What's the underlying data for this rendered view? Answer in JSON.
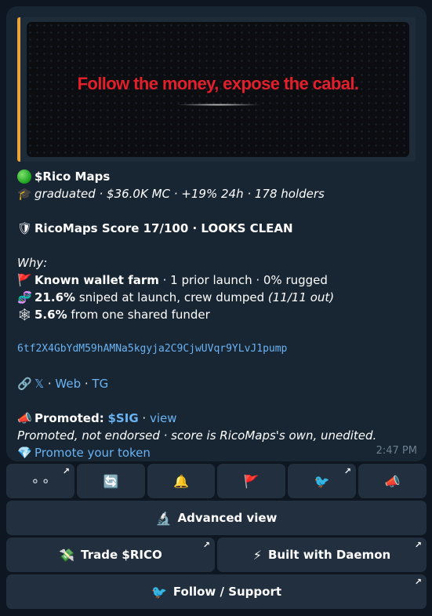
{
  "message": {
    "banner_text": "Follow the money, expose the cabal.",
    "header": {
      "status_icon": "green-circle-icon",
      "name": "$Rico Maps",
      "grad_icon": "graduation-cap-icon",
      "stats": "graduated · $36.0K MC · +19% 24h · 178 holders"
    },
    "score": {
      "icon": "shield-icon",
      "text": "RicoMaps Score 17/100 · LOOKS CLEAN"
    },
    "why": {
      "label": "Why:",
      "items": [
        {
          "icon": "red-flag-icon",
          "bold": "Known wallet farm",
          "rest": " · 1 prior launch · 0% rugged",
          "italic": ""
        },
        {
          "icon": "dna-icon",
          "bold": "21.6%",
          "rest": " sniped at launch, crew dumped ",
          "italic": "(11/11 out)"
        },
        {
          "icon": "spider-web-icon",
          "bold": "5.6%",
          "rest": " from one shared funder",
          "italic": ""
        }
      ]
    },
    "contract": "6tf2X4GbYdM59hAMNa5kgyja2C9CjwUVqr9YLvJ1pump",
    "links": {
      "icon": "link-icon",
      "x": "𝕏",
      "sep": " · ",
      "web": "Web",
      "tg": "TG"
    },
    "promo": {
      "icon": "megaphone-icon",
      "label": "Promoted:",
      "ticker": "$SIG",
      "sep": " · ",
      "view": "view",
      "disclaimer": "Promoted, not endorsed · score is RicoMaps's own, unedited.",
      "cta_icon": "gem-icon",
      "cta": "Promote your token"
    },
    "time": "2:47 PM"
  },
  "keyboard": {
    "row1": [
      {
        "icon": "bubbles-icon",
        "glyph": "⚬⚬",
        "external": true
      },
      {
        "icon": "refresh-icon",
        "glyph": "🔄",
        "external": false
      },
      {
        "icon": "bell-icon",
        "glyph": "🔔",
        "external": false
      },
      {
        "icon": "red-flag-icon",
        "glyph": "🚩",
        "external": false
      },
      {
        "icon": "bird-icon",
        "glyph": "🐦",
        "external": true
      },
      {
        "icon": "megaphone-icon",
        "glyph": "📣",
        "external": false
      }
    ],
    "advanced": {
      "icon": "microscope-icon",
      "glyph": "🔬",
      "label": "Advanced view"
    },
    "trade": {
      "icon": "money-wings-icon",
      "glyph": "💸",
      "label": "Trade $RICO"
    },
    "daemon": {
      "icon": "lightning-icon",
      "glyph": "⚡",
      "label": "Built with Daemon"
    },
    "follow": {
      "icon": "bird-icon",
      "glyph": "🐦",
      "label": "Follow / Support"
    },
    "external_arrow": "↗"
  }
}
